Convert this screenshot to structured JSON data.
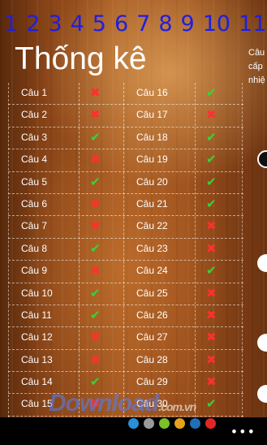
{
  "header": {
    "numbers": [
      "1",
      "2",
      "3",
      "4",
      "5",
      "6",
      "7",
      "8",
      "9",
      "10",
      "11"
    ],
    "title": "Thống kê",
    "side_lines": [
      "Câu",
      "cấp",
      "nhiệ"
    ]
  },
  "rows": [
    {
      "left": "Câu 1",
      "left_ok": false,
      "right": "Câu 16",
      "right_ok": true
    },
    {
      "left": "Câu 2",
      "left_ok": false,
      "right": "Câu 17",
      "right_ok": false
    },
    {
      "left": "Câu 3",
      "left_ok": true,
      "right": "Câu 18",
      "right_ok": true
    },
    {
      "left": "Câu 4",
      "left_ok": false,
      "right": "Câu 19",
      "right_ok": true
    },
    {
      "left": "Câu 5",
      "left_ok": true,
      "right": "Câu 20",
      "right_ok": true
    },
    {
      "left": "Câu 6",
      "left_ok": false,
      "right": "Câu 21",
      "right_ok": true
    },
    {
      "left": "Câu 7",
      "left_ok": false,
      "right": "Câu 22",
      "right_ok": false
    },
    {
      "left": "Câu 8",
      "left_ok": true,
      "right": "Câu 23",
      "right_ok": false
    },
    {
      "left": "Câu 9",
      "left_ok": false,
      "right": "Câu 24",
      "right_ok": true
    },
    {
      "left": "Câu 10",
      "left_ok": true,
      "right": "Câu 25",
      "right_ok": false
    },
    {
      "left": "Câu 11",
      "left_ok": true,
      "right": "Câu 26",
      "right_ok": false
    },
    {
      "left": "Câu 12",
      "left_ok": false,
      "right": "Câu 27",
      "right_ok": false
    },
    {
      "left": "Câu 13",
      "left_ok": false,
      "right": "Câu 28",
      "right_ok": false
    },
    {
      "left": "Câu 14",
      "left_ok": true,
      "right": "Câu 29",
      "right_ok": false
    },
    {
      "left": "Câu 15",
      "left_ok": false,
      "right": "Câu 30",
      "right_ok": true
    }
  ],
  "marks": {
    "ok": "✔",
    "bad": "✖"
  },
  "watermark": {
    "brand": "Download",
    "suffix": ".com.vn"
  },
  "appbar": {
    "colors": [
      "#2a8fd6",
      "#9a9a9a",
      "#7bbf2b",
      "#e5a21a",
      "#1f6fb5",
      "#e02727"
    ],
    "more": "•••"
  }
}
